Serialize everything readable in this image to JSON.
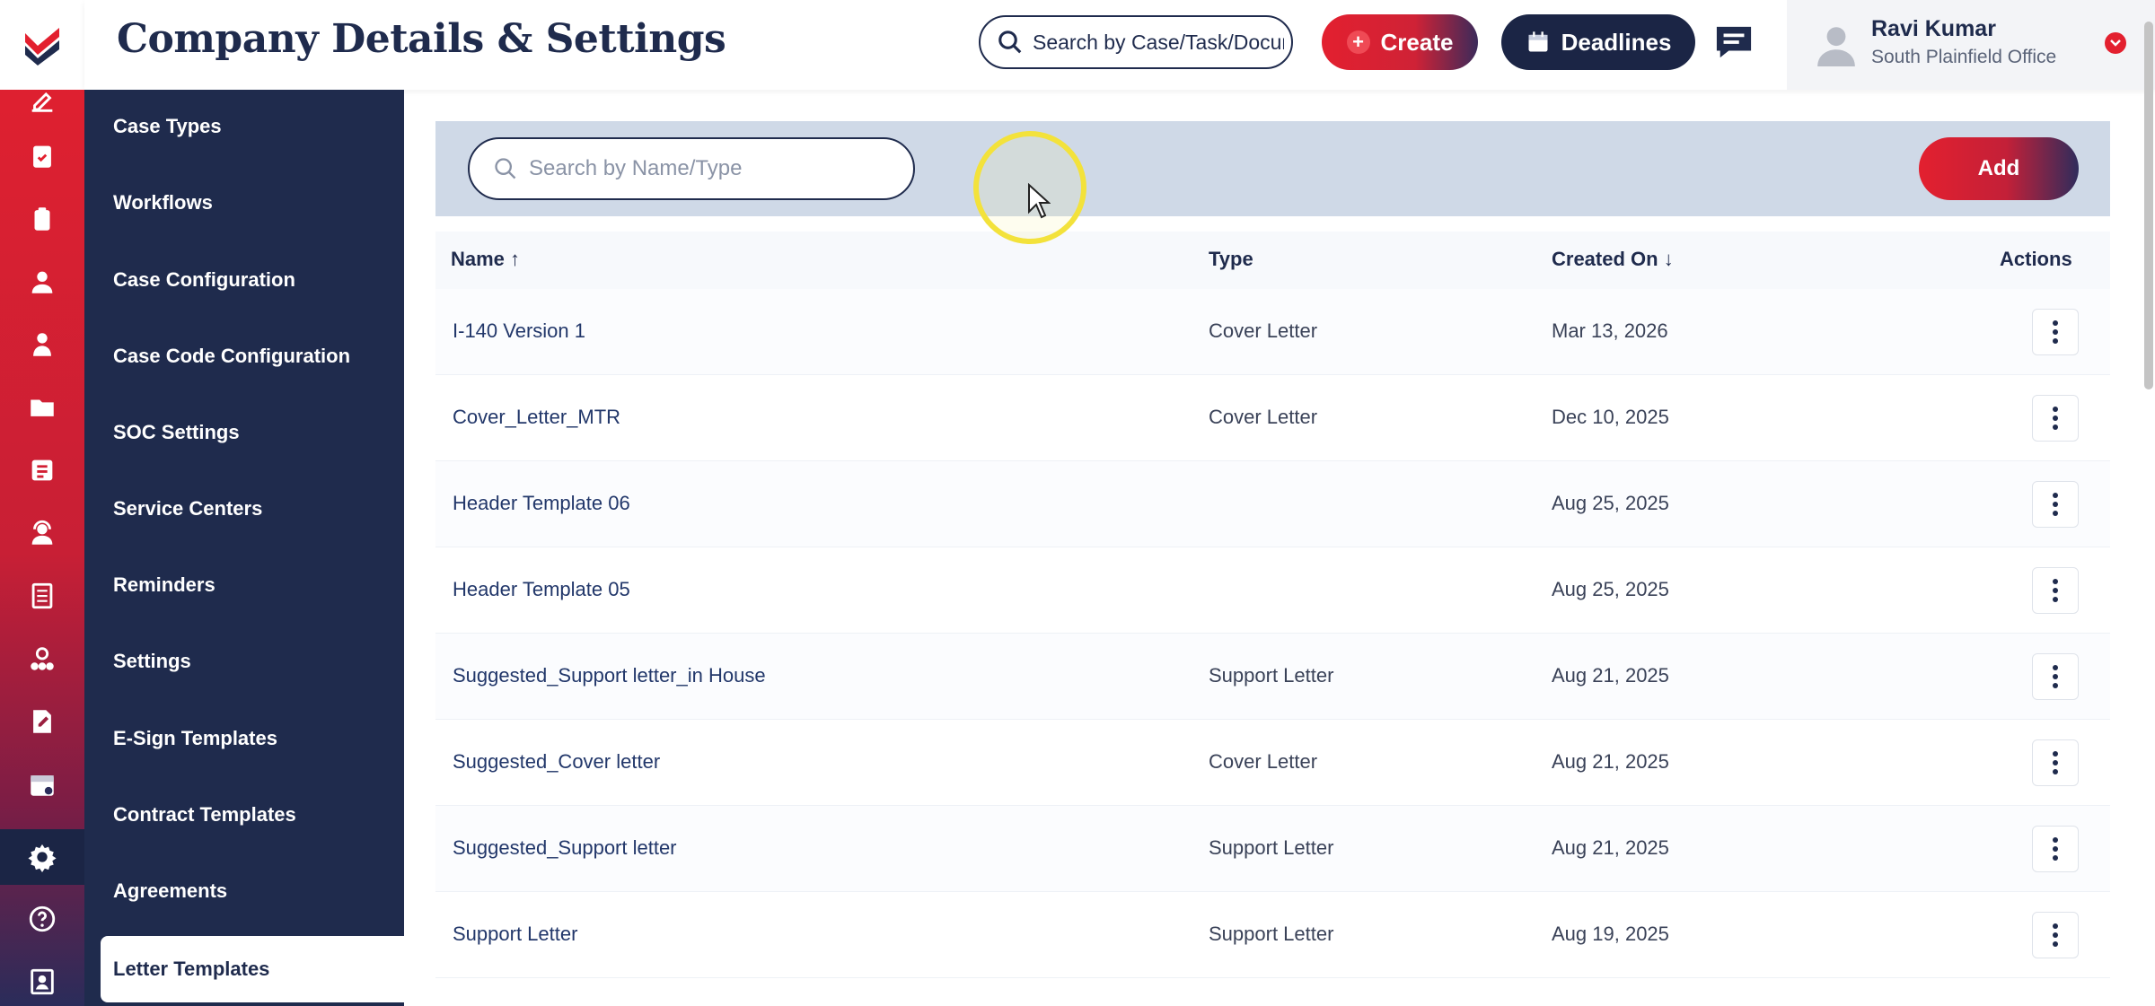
{
  "header": {
    "title": "Company Details & Settings",
    "search_placeholder": "Search by Case/Task/Document",
    "create_label": "Create",
    "deadlines_label": "Deadlines"
  },
  "user": {
    "name": "Ravi Kumar",
    "office": "South Plainfield Office"
  },
  "sidebar": {
    "items": [
      {
        "label": "Case Types"
      },
      {
        "label": "Workflows"
      },
      {
        "label": "Case Configuration"
      },
      {
        "label": "Case Code Configuration"
      },
      {
        "label": "SOC Settings"
      },
      {
        "label": "Service Centers"
      },
      {
        "label": "Reminders"
      },
      {
        "label": "Settings"
      },
      {
        "label": "E-Sign Templates"
      },
      {
        "label": "Contract Templates"
      },
      {
        "label": "Agreements"
      },
      {
        "label": "Letter Templates"
      }
    ],
    "active": "Letter Templates"
  },
  "toolbar": {
    "search_placeholder": "Search by Name/Type",
    "add_label": "Add"
  },
  "table": {
    "columns": {
      "name": "Name ↑",
      "type": "Type",
      "created": "Created On ↓",
      "actions": "Actions"
    },
    "rows": [
      {
        "name": "I-140 Version 1",
        "type": "Cover Letter",
        "created": "Mar 13, 2026"
      },
      {
        "name": "Cover_Letter_MTR",
        "type": "Cover Letter",
        "created": "Dec 10, 2025"
      },
      {
        "name": "Header Template 06",
        "type": "",
        "created": "Aug 25, 2025"
      },
      {
        "name": "Header Template 05",
        "type": "",
        "created": "Aug 25, 2025"
      },
      {
        "name": "Suggested_Support letter_in House",
        "type": "Support Letter",
        "created": "Aug 21, 2025"
      },
      {
        "name": "Suggested_Cover letter",
        "type": "Cover Letter",
        "created": "Aug 21, 2025"
      },
      {
        "name": "Suggested_Support letter",
        "type": "Support Letter",
        "created": "Aug 21, 2025"
      },
      {
        "name": "Support Letter",
        "type": "Support Letter",
        "created": "Aug 19, 2025"
      }
    ]
  },
  "colors": {
    "brand_red": "#e3202f",
    "navy": "#1f2b4d",
    "toolbar_bg": "#cfd9e7"
  }
}
